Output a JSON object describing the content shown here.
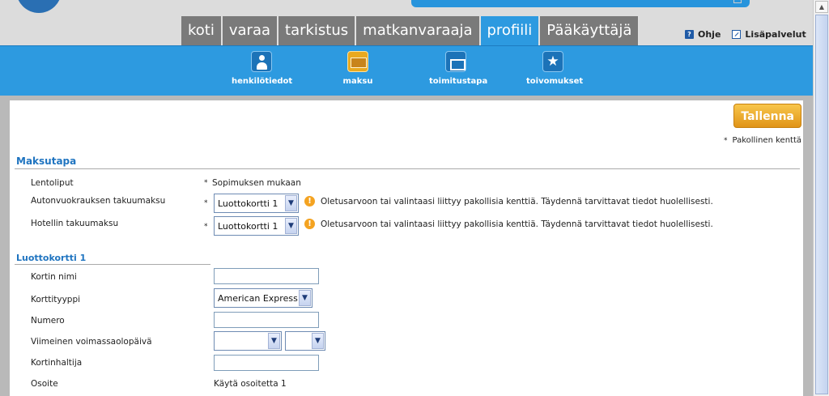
{
  "header": {
    "logo_text": "",
    "search_bar": ""
  },
  "main_tabs": [
    {
      "label": "koti",
      "active": false
    },
    {
      "label": "varaa",
      "active": false
    },
    {
      "label": "tarkistus",
      "active": false
    },
    {
      "label": "matkanvaraaja",
      "active": false
    },
    {
      "label": "profiili",
      "active": true
    },
    {
      "label": "Pääkäyttäjä",
      "active": false
    }
  ],
  "help": {
    "ohje": "Ohje",
    "lisapalvelut": "Lisäpalvelut"
  },
  "subnav": [
    {
      "label": "henkilötiedot",
      "icon": "person-icon"
    },
    {
      "label": "maksu",
      "icon": "money-icon"
    },
    {
      "label": "toimitustapa",
      "icon": "delivery-icon"
    },
    {
      "label": "toivomukset",
      "icon": "star-icon"
    }
  ],
  "toolbar": {
    "save_label": "Tallenna",
    "required_star": "*",
    "required_note": "Pakollinen kenttä"
  },
  "maksutapa": {
    "title": "Maksutapa",
    "rows": [
      {
        "label": "Lentoliput",
        "value": "Sopimuksen mukaan"
      },
      {
        "label": "Autonvuokrauksen takuumaksu",
        "select": "Luottokortti 1",
        "warning": "Oletusarvoon tai valintaasi liittyy pakollisia kenttiä. Täydennä tarvittavat tiedot huolellisesti."
      },
      {
        "label": "Hotellin takuumaksu",
        "select": "Luottokortti 1",
        "warning": "Oletusarvoon tai valintaasi liittyy pakollisia kenttiä. Täydennä tarvittavat tiedot huolellisesti."
      }
    ]
  },
  "luottokortti": {
    "title": "Luottokortti 1",
    "rows": [
      {
        "label": "Kortin nimi",
        "value": ""
      },
      {
        "label": "Korttityyppi",
        "select": "American Express"
      },
      {
        "label": "Numero",
        "value": ""
      },
      {
        "label": "Viimeinen voimassaolopäivä",
        "month": "",
        "year": ""
      },
      {
        "label": "Kortinhaltija",
        "value": ""
      },
      {
        "label": "Osoite",
        "value": "Käytä osoitetta 1"
      }
    ]
  },
  "colors": {
    "accent": "#2d9ae0",
    "tab_inactive": "#7a7a7a",
    "save": "#e9a91f",
    "section": "#1f74c0"
  }
}
